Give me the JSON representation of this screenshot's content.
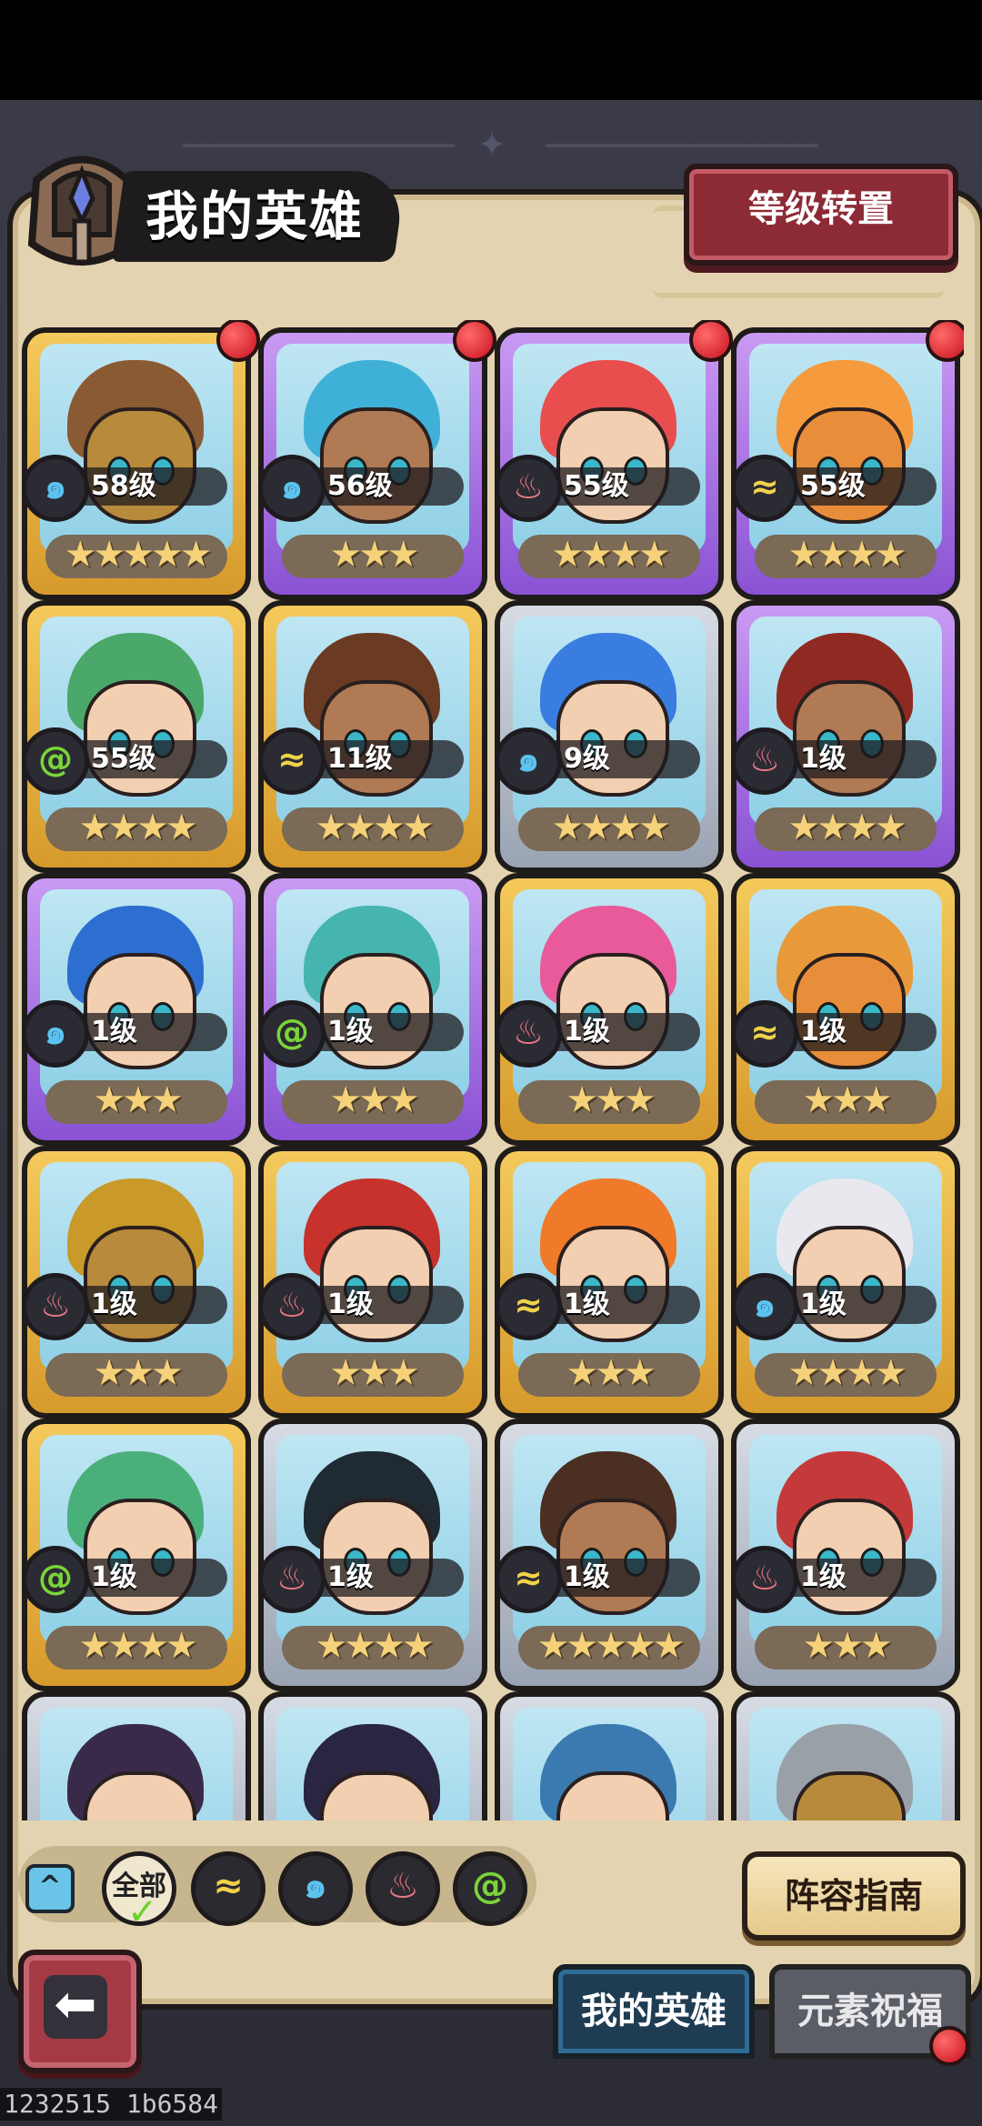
{
  "header": {
    "title": "我的英雄",
    "transfer_button": "等级转置"
  },
  "heroes": [
    {
      "level": "58级",
      "stars": "★★★★★",
      "element": "water",
      "frame": "gold",
      "dot": true,
      "hair": "#8a5a32",
      "face": "armor"
    },
    {
      "level": "56级",
      "stars": "★★★",
      "element": "water",
      "frame": "purple",
      "dot": true,
      "hair": "#3fb1d8",
      "face": "dark"
    },
    {
      "level": "55级",
      "stars": "★★★★",
      "element": "fire",
      "frame": "purple",
      "dot": true,
      "hair": "#e84e4e",
      "face": "light"
    },
    {
      "level": "55级",
      "stars": "★★★★",
      "element": "earth",
      "frame": "purple",
      "dot": true,
      "hair": "#f59b3d",
      "face": "fur"
    },
    {
      "level": "55级",
      "stars": "★★★★",
      "element": "wind",
      "frame": "gold",
      "dot": false,
      "hair": "#4aa86a",
      "face": "light"
    },
    {
      "level": "11级",
      "stars": "★★★★",
      "element": "earth",
      "frame": "gold",
      "dot": false,
      "hair": "#6a3a22",
      "face": "dark"
    },
    {
      "level": "9级",
      "stars": "★★★★",
      "element": "water",
      "frame": "silver",
      "dot": false,
      "hair": "#3a7de0",
      "face": "light"
    },
    {
      "level": "1级",
      "stars": "★★★★",
      "element": "fire",
      "frame": "purple",
      "dot": false,
      "hair": "#8e2a22",
      "face": "dark"
    },
    {
      "level": "1级",
      "stars": "★★★",
      "element": "water",
      "frame": "purple",
      "dot": false,
      "hair": "#2c6fd0",
      "face": "light"
    },
    {
      "level": "1级",
      "stars": "★★★",
      "element": "wind",
      "frame": "purple",
      "dot": false,
      "hair": "#46b5b0",
      "face": "light"
    },
    {
      "level": "1级",
      "stars": "★★★",
      "element": "fire",
      "frame": "gold",
      "dot": false,
      "hair": "#e85a9a",
      "face": "light"
    },
    {
      "level": "1级",
      "stars": "★★★",
      "element": "earth",
      "frame": "gold",
      "dot": false,
      "hair": "#e89a3a",
      "face": "fur"
    },
    {
      "level": "1级",
      "stars": "★★★",
      "element": "fire",
      "frame": "gold",
      "dot": false,
      "hair": "#c99a2a",
      "face": "armor"
    },
    {
      "level": "1级",
      "stars": "★★★",
      "element": "fire",
      "frame": "gold",
      "dot": false,
      "hair": "#c8322c",
      "face": "light"
    },
    {
      "level": "1级",
      "stars": "★★★",
      "element": "earth",
      "frame": "gold",
      "dot": false,
      "hair": "#ef7a2a",
      "face": "light"
    },
    {
      "level": "1级",
      "stars": "★★★★",
      "element": "water",
      "frame": "gold",
      "dot": false,
      "hair": "#e8e8ee",
      "face": "light"
    },
    {
      "level": "1级",
      "stars": "★★★★",
      "element": "wind",
      "frame": "gold",
      "dot": false,
      "hair": "#4ab07a",
      "face": "light"
    },
    {
      "level": "1级",
      "stars": "★★★★",
      "element": "fire",
      "frame": "silver",
      "dot": false,
      "hair": "#1f2a33",
      "face": "light"
    },
    {
      "level": "1级",
      "stars": "★★★★★",
      "element": "earth",
      "frame": "silver",
      "dot": false,
      "hair": "#4a2f22",
      "face": "dark"
    },
    {
      "level": "1级",
      "stars": "★★★",
      "element": "fire",
      "frame": "silver",
      "dot": false,
      "hair": "#c43a3a",
      "face": "light"
    },
    {
      "level": "",
      "stars": "",
      "element": "",
      "frame": "silver",
      "dot": false,
      "hair": "#3a2a4a",
      "face": "light"
    },
    {
      "level": "",
      "stars": "",
      "element": "",
      "frame": "silver",
      "dot": false,
      "hair": "#2a2540",
      "face": "light"
    },
    {
      "level": "",
      "stars": "",
      "element": "",
      "frame": "silver",
      "dot": false,
      "hair": "#3a7ab0",
      "face": "light"
    },
    {
      "level": "",
      "stars": "",
      "element": "",
      "frame": "silver",
      "dot": false,
      "hair": "#9aa0a8",
      "face": "armor"
    }
  ],
  "element_glyphs": {
    "water": "๑",
    "fire": "♨",
    "wind": "@",
    "earth": "≈"
  },
  "filters": {
    "all_label": "全部",
    "chips": [
      "earth",
      "water",
      "fire",
      "wind"
    ]
  },
  "buttons": {
    "guide": "阵容指南"
  },
  "tabs": {
    "my_heroes": "我的英雄",
    "element_blessing": "元素祝福"
  },
  "build_id": "1232515 1b6584"
}
